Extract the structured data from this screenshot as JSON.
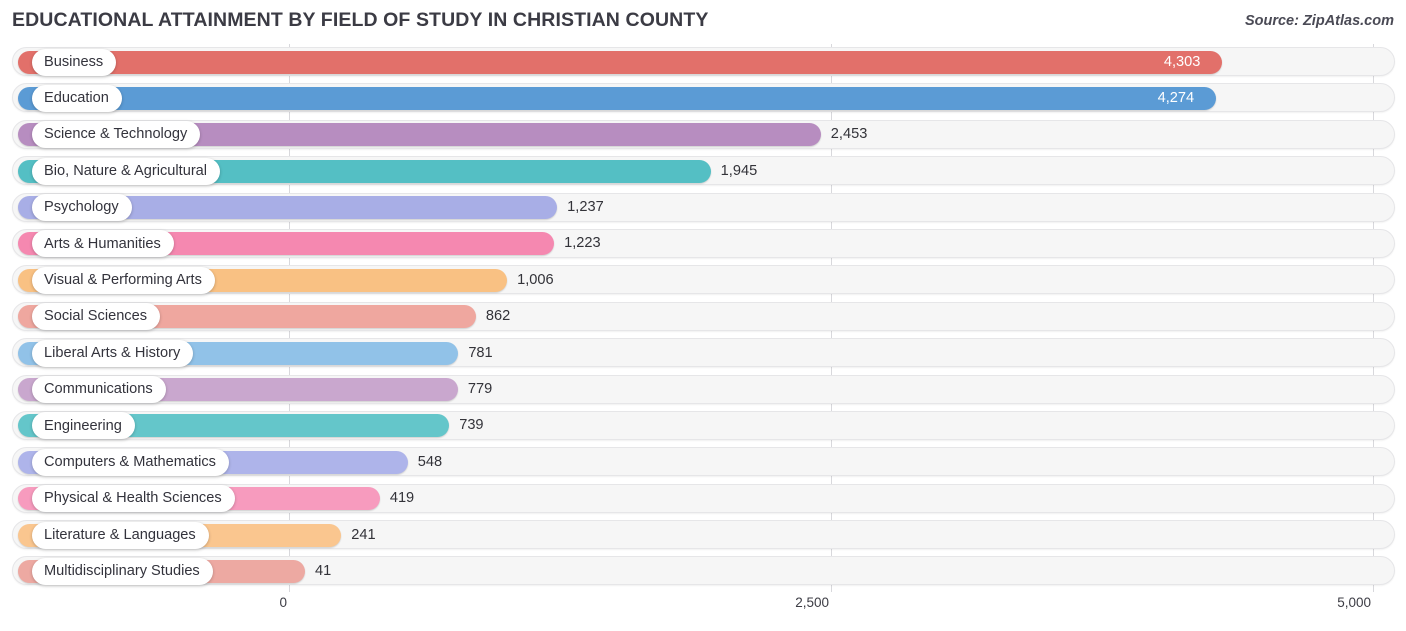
{
  "header": {
    "title": "EDUCATIONAL ATTAINMENT BY FIELD OF STUDY IN CHRISTIAN COUNTY",
    "source": "Source: ZipAtlas.com"
  },
  "chart_data": {
    "type": "bar",
    "orientation": "horizontal",
    "title": "EDUCATIONAL ATTAINMENT BY FIELD OF STUDY IN CHRISTIAN COUNTY",
    "xlabel": "",
    "ylabel": "",
    "xlim": [
      0,
      5000
    ],
    "grid": true,
    "legend": "none",
    "xticks": [
      0,
      2500,
      5000
    ],
    "xtick_labels": [
      "0",
      "2,500",
      "5,000"
    ],
    "categories": [
      "Business",
      "Education",
      "Science & Technology",
      "Bio, Nature & Agricultural",
      "Psychology",
      "Arts & Humanities",
      "Visual & Performing Arts",
      "Social Sciences",
      "Liberal Arts & History",
      "Communications",
      "Engineering",
      "Computers & Mathematics",
      "Physical & Health Sciences",
      "Literature & Languages",
      "Multidisciplinary Studies"
    ],
    "values": [
      4303,
      4274,
      2453,
      1945,
      1237,
      1223,
      1006,
      862,
      781,
      779,
      739,
      548,
      419,
      241,
      41
    ],
    "value_labels": [
      "4,303",
      "4,274",
      "2,453",
      "1,945",
      "1,237",
      "1,223",
      "1,006",
      "862",
      "781",
      "779",
      "739",
      "548",
      "419",
      "241",
      "41"
    ],
    "colors": [
      "#e2706a",
      "#5b9bd5",
      "#b78dc0",
      "#54bfc4",
      "#a8aee6",
      "#f588b0",
      "#f9c183",
      "#efa79f",
      "#91c2e8",
      "#c9a7ce",
      "#64c6ca",
      "#aeb4ea",
      "#f79bbe",
      "#fac68f",
      "#eda9a2"
    ]
  }
}
